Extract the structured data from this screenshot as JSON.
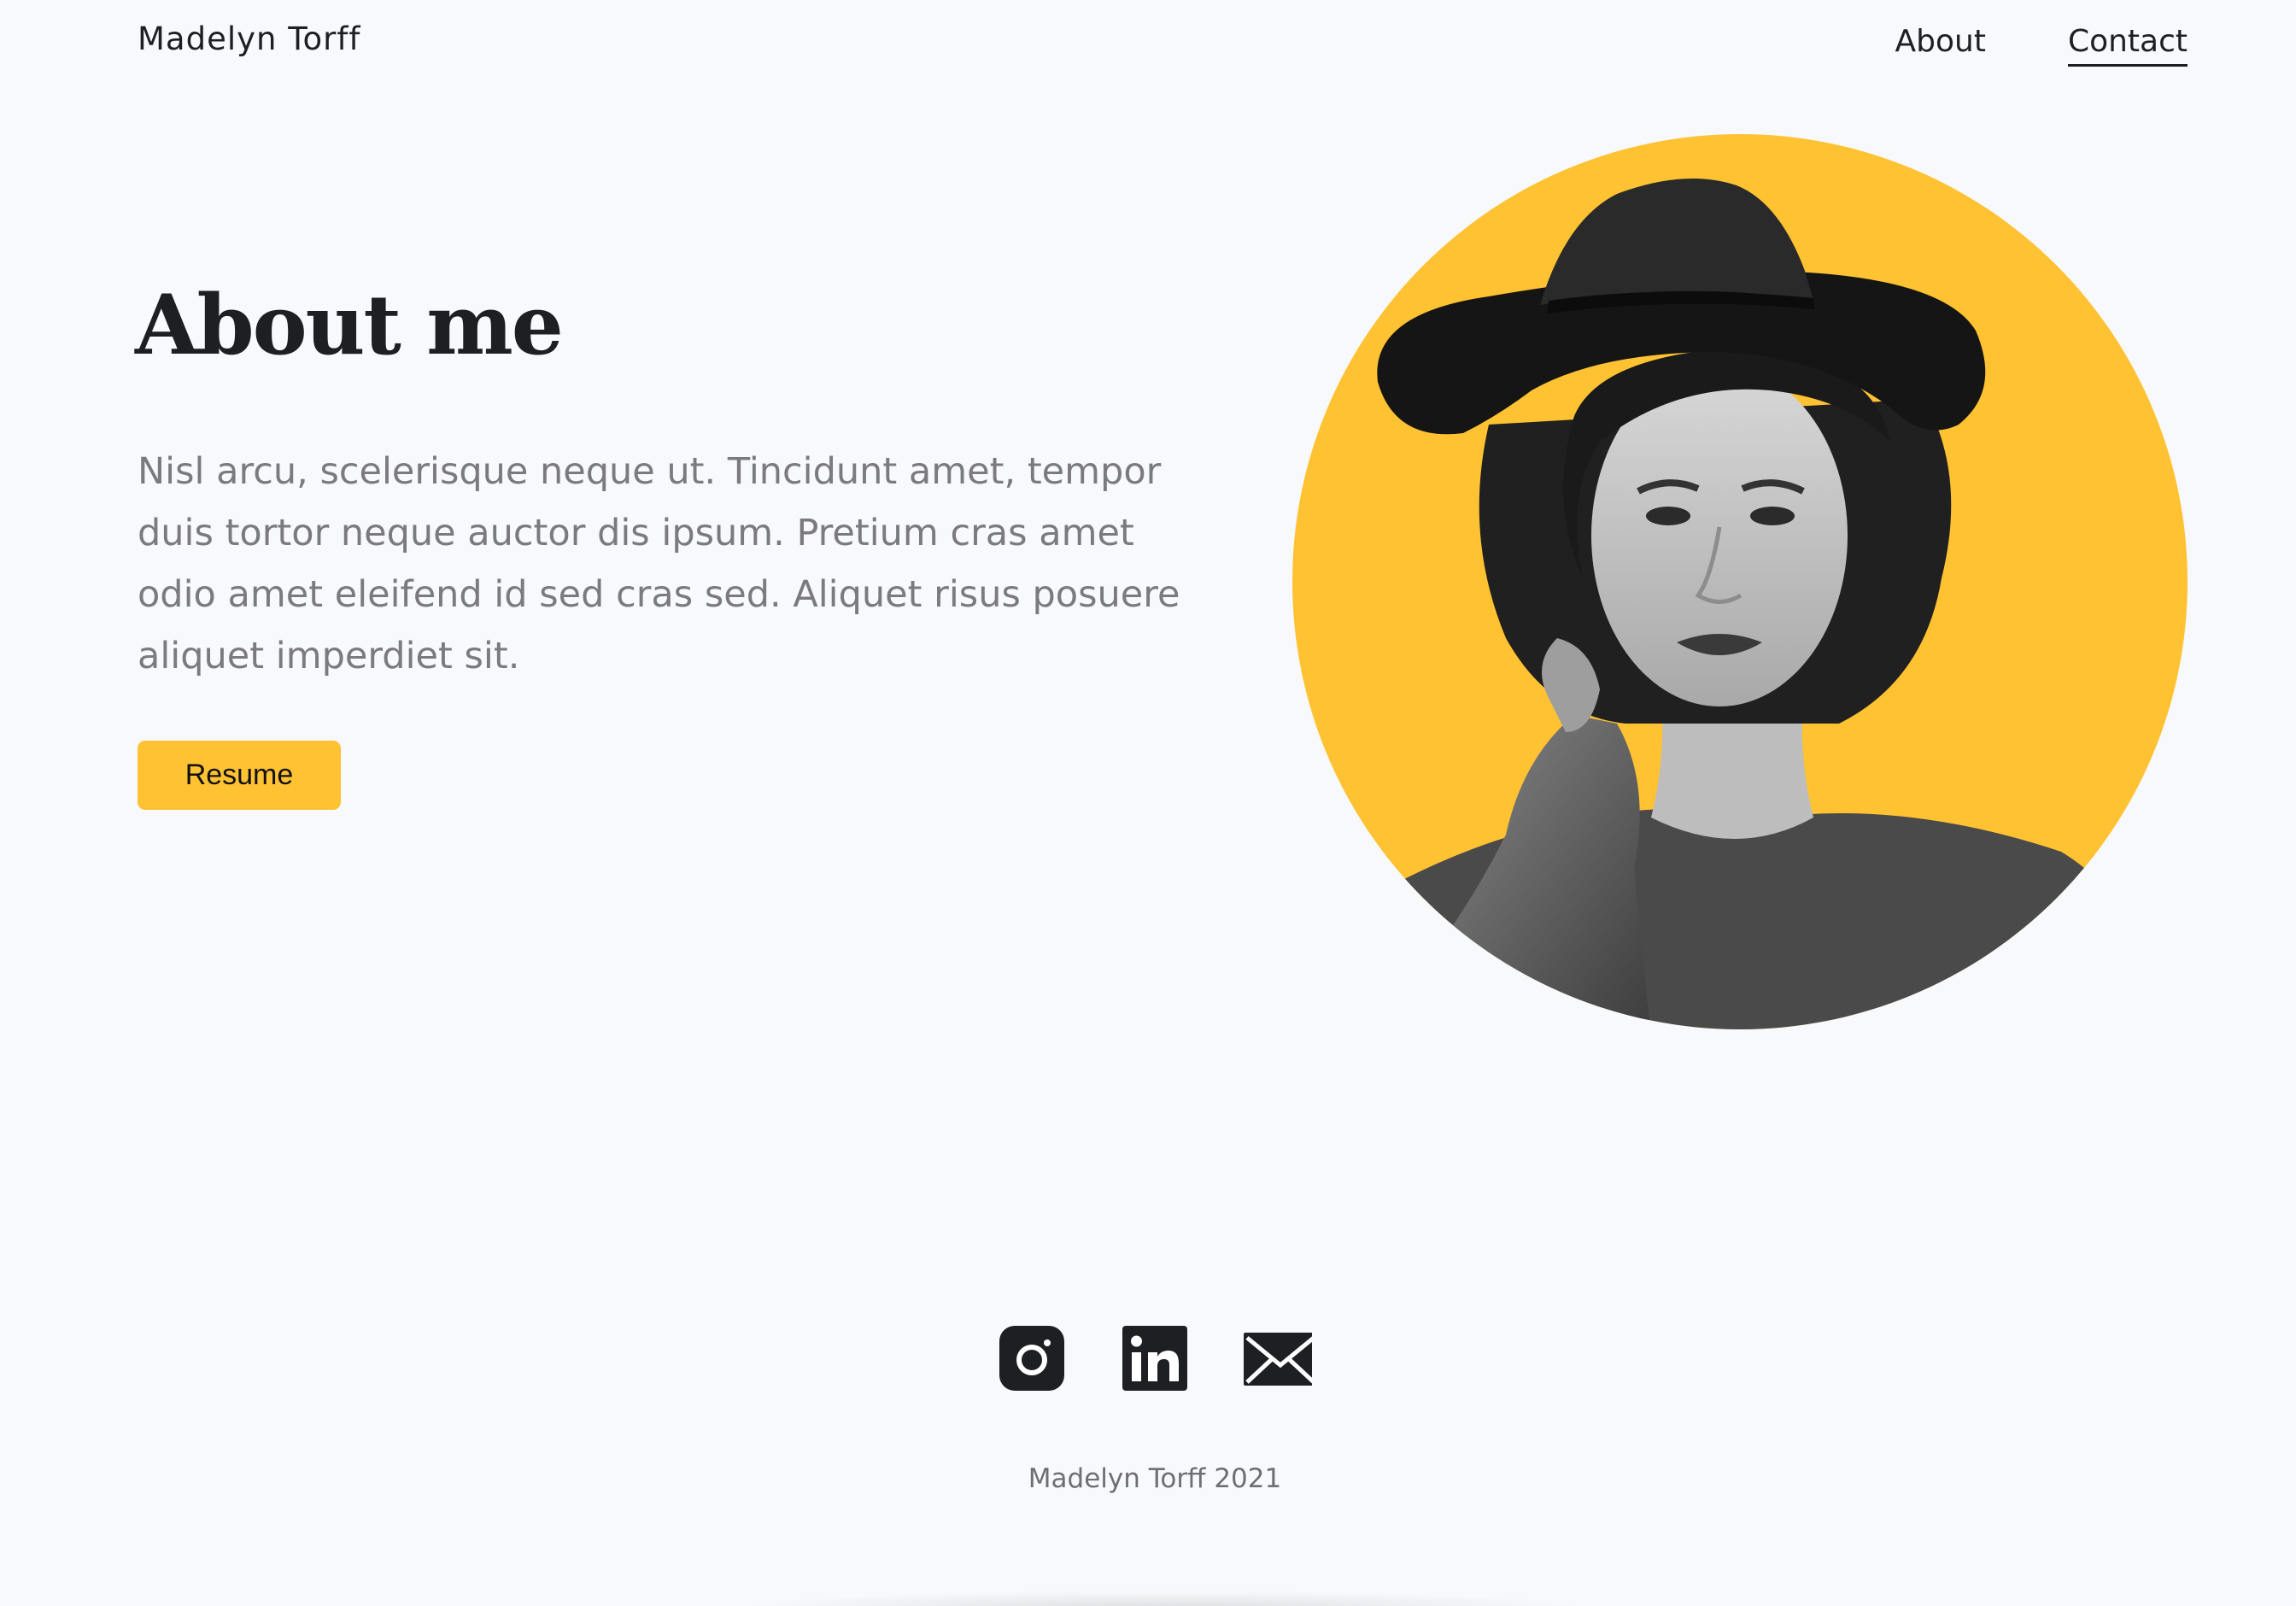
{
  "header": {
    "brand": "Madelyn Torff",
    "nav": [
      {
        "label": "About",
        "active": false
      },
      {
        "label": "Contact",
        "active": true
      }
    ]
  },
  "hero": {
    "title": "About me",
    "body": "Nisl arcu, scelerisque neque ut. Tincidunt amet, tempor duis tortor neque auctor dis ipsum. Pretium cras amet odio amet eleifend id sed cras sed. Aliquet risus posuere aliquet imperdiet sit.",
    "button_label": "Resume",
    "portrait_icon": "woman-portrait-photo"
  },
  "footer": {
    "social_icons": [
      "instagram-icon",
      "linkedin-icon",
      "mail-icon"
    ],
    "copyright": "Madelyn Torff 2021"
  },
  "colors": {
    "accent": "#fec232",
    "text_dark": "#1d1f23",
    "text_muted": "#7b7b7f",
    "background": "#f8f9fc"
  }
}
